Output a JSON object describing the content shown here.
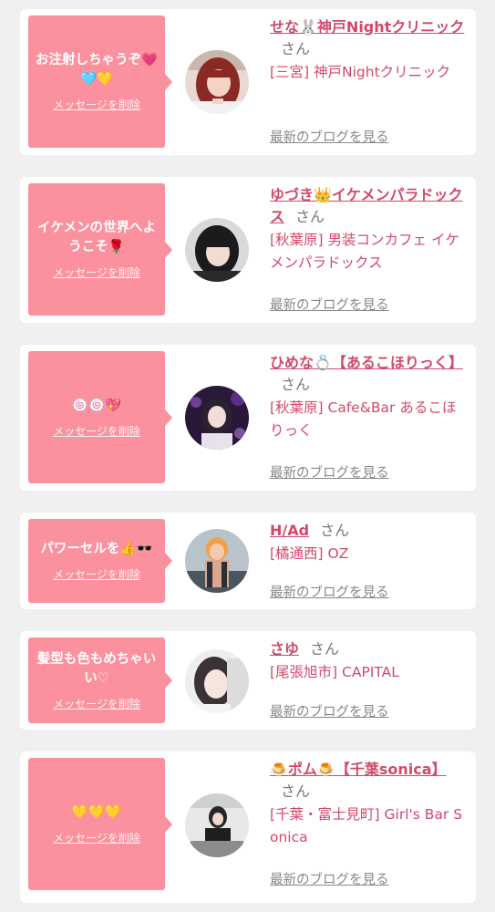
{
  "delete_label": "メッセージを削除",
  "blog_label": "最新のブログを見る",
  "san_label": "さん",
  "colors": {
    "bubble": "#fb919e",
    "accent": "#d14a6a",
    "muted": "#888888",
    "background": "#f0f0f0"
  },
  "cards": [
    {
      "message": "お注射しちゃうぞ💗🩵💛",
      "name": "せな🐰神戸Nightクリニック",
      "shop": "[三宮] 神戸Nightクリニック",
      "avatar_icon": "avatar-photo-red-hair"
    },
    {
      "message": "イケメンの世界へようこそ🌹",
      "name": "ゆづき👑イケメンパラドックス",
      "shop": "[秋葉原] 男装コンカフェ イケメンパラドックス",
      "avatar_icon": "avatar-photo-black-hair"
    },
    {
      "message": "🍥🍥💖",
      "name": "ひめな💍【あるこほりっく】",
      "shop": "[秋葉原] Cafe&Bar あるこほりっく",
      "avatar_icon": "avatar-photo-purple-lights"
    },
    {
      "message": "パワーセルを👍🕶️",
      "name": "H/Ad",
      "shop": "[橘通西] OZ",
      "avatar_icon": "avatar-illustration-orange-hair"
    },
    {
      "message": "髪型も色もめちゃいい♡",
      "name": "さゆ",
      "shop": "[尾張旭市] CAPITAL",
      "avatar_icon": "avatar-photo-light"
    },
    {
      "message": "💛💛💛",
      "name": "🍮ポム🍮【千葉sonica】",
      "shop": "[千葉・富士見町] Girl's Bar Sonica",
      "avatar_icon": "avatar-photo-bar"
    }
  ]
}
